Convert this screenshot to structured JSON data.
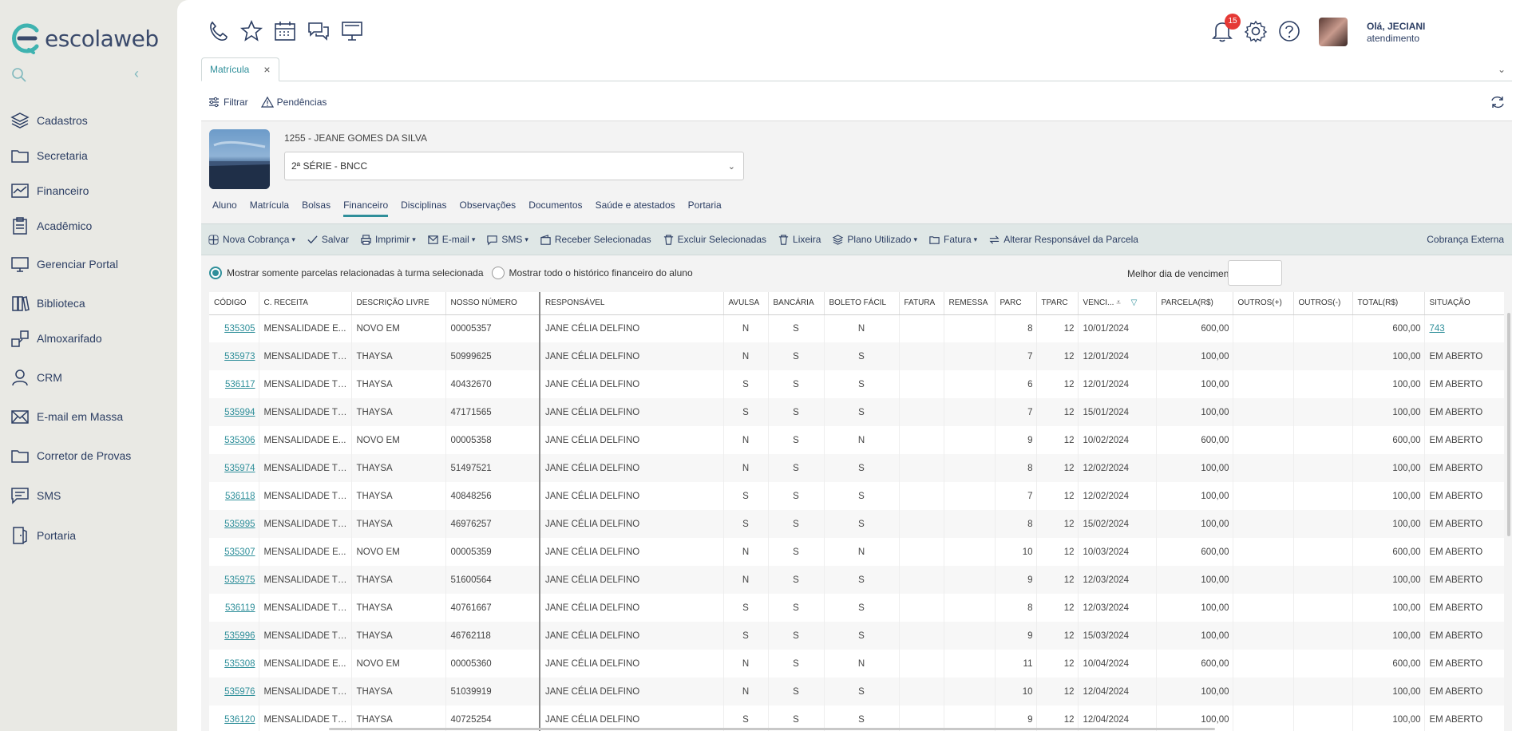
{
  "brand": {
    "name": "escolaweb",
    "accent": "#2f8f9a"
  },
  "sidebar": {
    "items": [
      {
        "label": "Cadastros",
        "icon": "layers-icon"
      },
      {
        "label": "Secretaria",
        "icon": "folder-icon"
      },
      {
        "label": "Financeiro",
        "icon": "chart-icon"
      },
      {
        "label": "Acadêmico",
        "icon": "clipboard-icon"
      },
      {
        "label": "Gerenciar Portal",
        "icon": "monitor-icon"
      },
      {
        "label": "Biblioteca",
        "icon": "book-icon"
      },
      {
        "label": "Almoxarifado",
        "icon": "boxes-icon"
      },
      {
        "label": "CRM",
        "icon": "person-icon"
      },
      {
        "label": "E-mail em Massa",
        "icon": "mail-icon"
      },
      {
        "label": "Corretor de Provas",
        "icon": "folder-icon"
      },
      {
        "label": "SMS",
        "icon": "chat-icon"
      },
      {
        "label": "Portaria",
        "icon": "door-icon"
      }
    ]
  },
  "header": {
    "notifications": "15",
    "greeting": "Olá, JECIANI",
    "role": "atendimento"
  },
  "tabs": {
    "active": "Matrícula"
  },
  "actions": {
    "filter": "Filtrar",
    "pending": "Pendências"
  },
  "student": {
    "name": "1255 - JEANE GOMES DA SILVA",
    "class": "2ª SÉRIE - BNCC"
  },
  "subtabs": [
    "Aluno",
    "Matrícula",
    "Bolsas",
    "Financeiro",
    "Disciplinas",
    "Observações",
    "Documentos",
    "Saúde e atestados",
    "Portaria"
  ],
  "toolbar": {
    "new_charge": "Nova Cobrança",
    "save": "Salvar",
    "print": "Imprimir",
    "email": "E-mail",
    "sms": "SMS",
    "receive": "Receber Selecionadas",
    "delete": "Excluir Selecionadas",
    "trash": "Lixeira",
    "plan": "Plano Utilizado",
    "invoice": "Fatura",
    "change_resp": "Alterar Responsável da Parcela",
    "external": "Cobrança Externa"
  },
  "filters": {
    "opt1": "Mostrar somente parcelas relacionadas à turma selecionada",
    "opt2": "Mostrar todo o histórico financeiro do aluno",
    "best_day": "Melhor dia de vencimento:"
  },
  "table": {
    "columns": [
      "CÓDIGO",
      "C. RECEITA",
      "DESCRIÇÃO LIVRE",
      "NOSSO NÚMERO",
      "RESPONSÁVEL",
      "AVULSA",
      "BANCÁRIA",
      "BOLETO FÁCIL",
      "FATURA",
      "REMESSA",
      "PARC",
      "TPARC",
      "VENCI...",
      "PARCELA(R$)",
      "OUTROS(+)",
      "OUTROS(-)",
      "TOTAL(R$)",
      "SITUAÇÃO"
    ],
    "rows": [
      [
        "535305",
        "MENSALIDADE E...",
        "NOVO EM",
        "00005357",
        "JANE CÉLIA DELFINO",
        "N",
        "S",
        "N",
        "",
        "",
        "8",
        "12",
        "10/01/2024",
        "600,00",
        "",
        "",
        "600,00",
        "743"
      ],
      [
        "535973",
        "MENSALIDADE TES...",
        "THAYSA",
        "50999625",
        "JANE CÉLIA DELFINO",
        "N",
        "S",
        "S",
        "",
        "",
        "7",
        "12",
        "12/01/2024",
        "100,00",
        "",
        "",
        "100,00",
        "EM ABERTO"
      ],
      [
        "536117",
        "MENSALIDADE TES...",
        "THAYSA",
        "40432670",
        "JANE CÉLIA DELFINO",
        "S",
        "S",
        "S",
        "",
        "",
        "6",
        "12",
        "12/01/2024",
        "100,00",
        "",
        "",
        "100,00",
        "EM ABERTO"
      ],
      [
        "535994",
        "MENSALIDADE TES...",
        "THAYSA",
        "47171565",
        "JANE CÉLIA DELFINO",
        "S",
        "S",
        "S",
        "",
        "",
        "7",
        "12",
        "15/01/2024",
        "100,00",
        "",
        "",
        "100,00",
        "EM ABERTO"
      ],
      [
        "535306",
        "MENSALIDADE E...",
        "NOVO EM",
        "00005358",
        "JANE CÉLIA DELFINO",
        "N",
        "S",
        "N",
        "",
        "",
        "9",
        "12",
        "10/02/2024",
        "600,00",
        "",
        "",
        "600,00",
        "EM ABERTO"
      ],
      [
        "535974",
        "MENSALIDADE TES...",
        "THAYSA",
        "51497521",
        "JANE CÉLIA DELFINO",
        "N",
        "S",
        "S",
        "",
        "",
        "8",
        "12",
        "12/02/2024",
        "100,00",
        "",
        "",
        "100,00",
        "EM ABERTO"
      ],
      [
        "536118",
        "MENSALIDADE TES...",
        "THAYSA",
        "40848256",
        "JANE CÉLIA DELFINO",
        "S",
        "S",
        "S",
        "",
        "",
        "7",
        "12",
        "12/02/2024",
        "100,00",
        "",
        "",
        "100,00",
        "EM ABERTO"
      ],
      [
        "535995",
        "MENSALIDADE TES...",
        "THAYSA",
        "46976257",
        "JANE CÉLIA DELFINO",
        "S",
        "S",
        "S",
        "",
        "",
        "8",
        "12",
        "15/02/2024",
        "100,00",
        "",
        "",
        "100,00",
        "EM ABERTO"
      ],
      [
        "535307",
        "MENSALIDADE E...",
        "NOVO EM",
        "00005359",
        "JANE CÉLIA DELFINO",
        "N",
        "S",
        "N",
        "",
        "",
        "10",
        "12",
        "10/03/2024",
        "600,00",
        "",
        "",
        "600,00",
        "EM ABERTO"
      ],
      [
        "535975",
        "MENSALIDADE TES...",
        "THAYSA",
        "51600564",
        "JANE CÉLIA DELFINO",
        "N",
        "S",
        "S",
        "",
        "",
        "9",
        "12",
        "12/03/2024",
        "100,00",
        "",
        "",
        "100,00",
        "EM ABERTO"
      ],
      [
        "536119",
        "MENSALIDADE TES...",
        "THAYSA",
        "40761667",
        "JANE CÉLIA DELFINO",
        "S",
        "S",
        "S",
        "",
        "",
        "8",
        "12",
        "12/03/2024",
        "100,00",
        "",
        "",
        "100,00",
        "EM ABERTO"
      ],
      [
        "535996",
        "MENSALIDADE TES...",
        "THAYSA",
        "46762118",
        "JANE CÉLIA DELFINO",
        "S",
        "S",
        "S",
        "",
        "",
        "9",
        "12",
        "15/03/2024",
        "100,00",
        "",
        "",
        "100,00",
        "EM ABERTO"
      ],
      [
        "535308",
        "MENSALIDADE E...",
        "NOVO EM",
        "00005360",
        "JANE CÉLIA DELFINO",
        "N",
        "S",
        "N",
        "",
        "",
        "11",
        "12",
        "10/04/2024",
        "600,00",
        "",
        "",
        "600,00",
        "EM ABERTO"
      ],
      [
        "535976",
        "MENSALIDADE TES...",
        "THAYSA",
        "51039919",
        "JANE CÉLIA DELFINO",
        "N",
        "S",
        "S",
        "",
        "",
        "10",
        "12",
        "12/04/2024",
        "100,00",
        "",
        "",
        "100,00",
        "EM ABERTO"
      ],
      [
        "536120",
        "MENSALIDADE TES...",
        "THAYSA",
        "40725254",
        "JANE CÉLIA DELFINO",
        "S",
        "S",
        "S",
        "",
        "",
        "9",
        "12",
        "12/04/2024",
        "100,00",
        "",
        "",
        "100,00",
        "EM ABERTO"
      ]
    ]
  }
}
